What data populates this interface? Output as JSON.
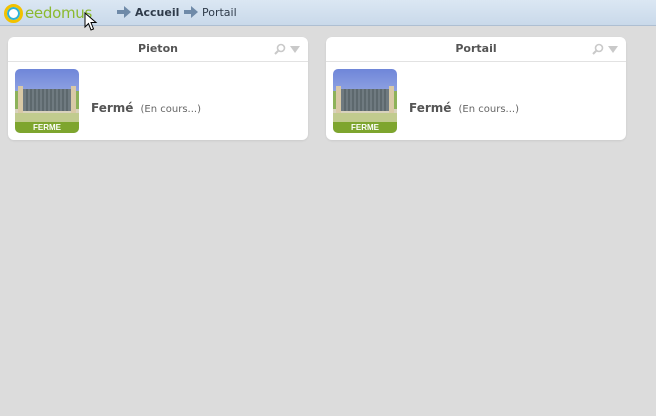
{
  "header": {
    "logo_text": "eedomus",
    "breadcrumb": [
      {
        "label": "Accueil"
      },
      {
        "label": "Portail"
      }
    ]
  },
  "widgets": [
    {
      "title": "Pieton",
      "image_icon": "closed-gate-image",
      "image_label": "FERME",
      "status": "Fermé",
      "substatus": "(En cours...)"
    },
    {
      "title": "Portail",
      "image_icon": "closed-gate-image",
      "image_label": "FERME",
      "status": "Fermé",
      "substatus": "(En cours...)"
    }
  ],
  "colors": {
    "background": "#dcdcdc",
    "topbar": "#d2e0ef",
    "brand_green": "#8bb92f",
    "label_green": "#7ea52e"
  }
}
